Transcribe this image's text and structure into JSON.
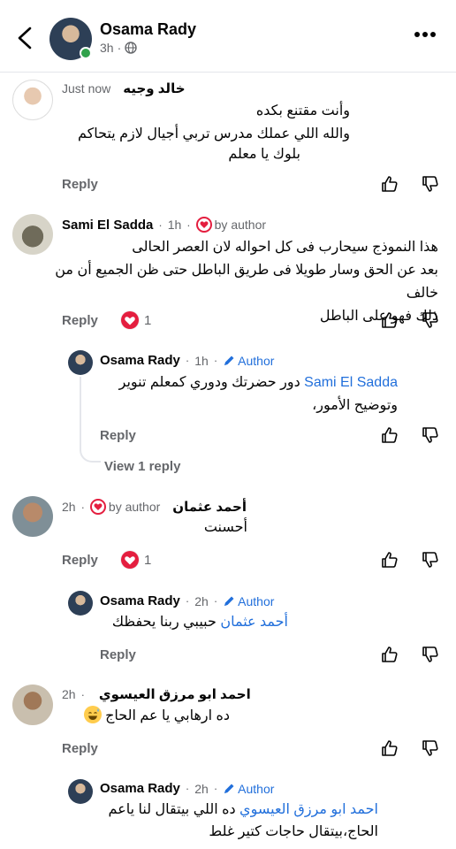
{
  "header": {
    "name": "Osama Rady",
    "time": "3h",
    "dot": "·"
  },
  "comments": [
    {
      "name": "خالد وجيه",
      "time": "Just now",
      "lines": [
        "وأنت مقتنع بكده",
        "والله اللي عملك مدرس تربي أجيال لازم يتحاكم",
        "بلوك يا معلم"
      ],
      "reply": "Reply"
    },
    {
      "name": "Sami El Sadda",
      "time": "1h",
      "dot": "·",
      "by_author": "by author",
      "lines": [
        "هذا النموذج سيحارب فى كل احواله لان العصر الحالى",
        "بعد عن الحق وسار طويلا فى طريق الباطل حتى ظن الجميع أن من خالف",
        "ذلك فهو على الباطل"
      ],
      "reply": "Reply",
      "reactions": "1",
      "reply_item": {
        "name": "Osama Rady",
        "time": "1h",
        "dot": "·",
        "author": "Author",
        "mention": "Sami El Sadda",
        "line1": " دور حضرتك ودوري كمعلم تنوير",
        "line2": "وتوضيح الأمور،",
        "reply": "Reply"
      },
      "view_reply": "View 1 reply"
    },
    {
      "name": "أحمد عثمان",
      "time": "2h",
      "dot": "·",
      "by_author": "by author",
      "lines": [
        "أحسنت"
      ],
      "reply": "Reply",
      "reactions": "1",
      "reply_item": {
        "name": "Osama Rady",
        "time": "2h",
        "dot": "·",
        "author": "Author",
        "mention": "أحمد عثمان",
        "line1": " حبيبي ربنا يحفظك",
        "reply": "Reply"
      }
    },
    {
      "name": "احمد ابو مرزق العيسوي",
      "time": "2h",
      "dot": "·",
      "lines": [
        "ده ارهابي يا عم الحاج"
      ],
      "emoji": "sweat-smile-emoji",
      "reply": "Reply",
      "reply_item": {
        "name": "Osama Rady",
        "time": "2h",
        "dot": "·",
        "author": "Author",
        "mention": "احمد ابو مرزق العيسوي",
        "line1": " ده اللي بيتقال لنا ياعم",
        "line2": "الحاج،بيتقال حاجات كتير غلط"
      }
    }
  ],
  "icons": {
    "back": "chevron-left-icon",
    "privacy": "globe-icon",
    "more": "more-dots-icon",
    "like": "thumbs-up-icon",
    "dislike": "thumbs-down-icon",
    "heart": "heart-icon",
    "pencil": "pencil-icon"
  },
  "colors": {
    "link": "#216fdb",
    "heart": "#e41e3f",
    "muted": "#65676b",
    "online": "#31a24c"
  }
}
